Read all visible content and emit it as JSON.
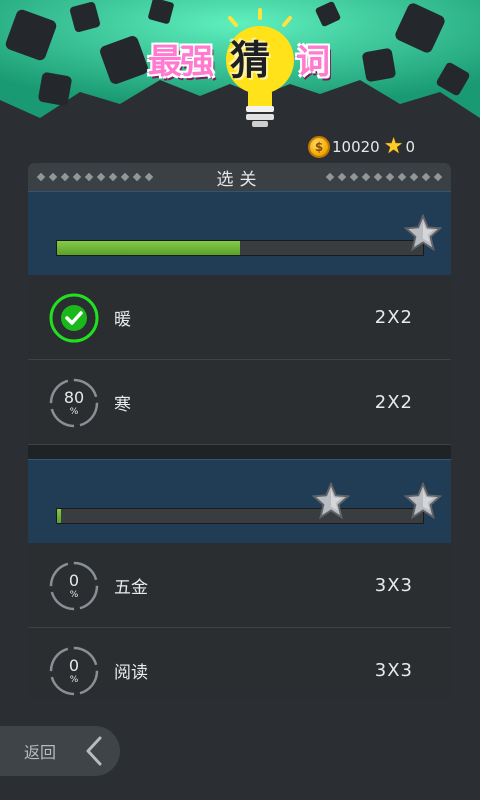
{
  "header": {
    "logo_text_1": "最强",
    "logo_text_2": "猜",
    "logo_text_3": "词",
    "logo_icon": "lightbulb-icon",
    "coins": "10020",
    "coin_icon": "dollar-coin-icon",
    "stars": "0",
    "star_icon": "star-icon"
  },
  "panel": {
    "title": "选关"
  },
  "stages": [
    {
      "progress": 0.5,
      "stars_shown": 1,
      "levels": [
        {
          "word": "暖",
          "size": "2X2",
          "state": "done",
          "percent": "100"
        },
        {
          "word": "寒",
          "size": "2X2",
          "state": "progress",
          "percent": "80",
          "percent_sign": "%"
        }
      ]
    },
    {
      "progress": 0.01,
      "stars_shown": 2,
      "levels": [
        {
          "word": "五金",
          "size": "3X3",
          "state": "progress",
          "percent": "0",
          "percent_sign": "%"
        },
        {
          "word": "阅读",
          "size": "3X3",
          "state": "progress",
          "percent": "0",
          "percent_sign": "%"
        }
      ]
    }
  ],
  "back": {
    "label": "返回",
    "icon": "chevron-left-icon"
  },
  "colors": {
    "accent_green": "#6ab83a",
    "header_teal": "#3ad6a4",
    "stage_blue": "#213d55",
    "check_green": "#20e020"
  }
}
